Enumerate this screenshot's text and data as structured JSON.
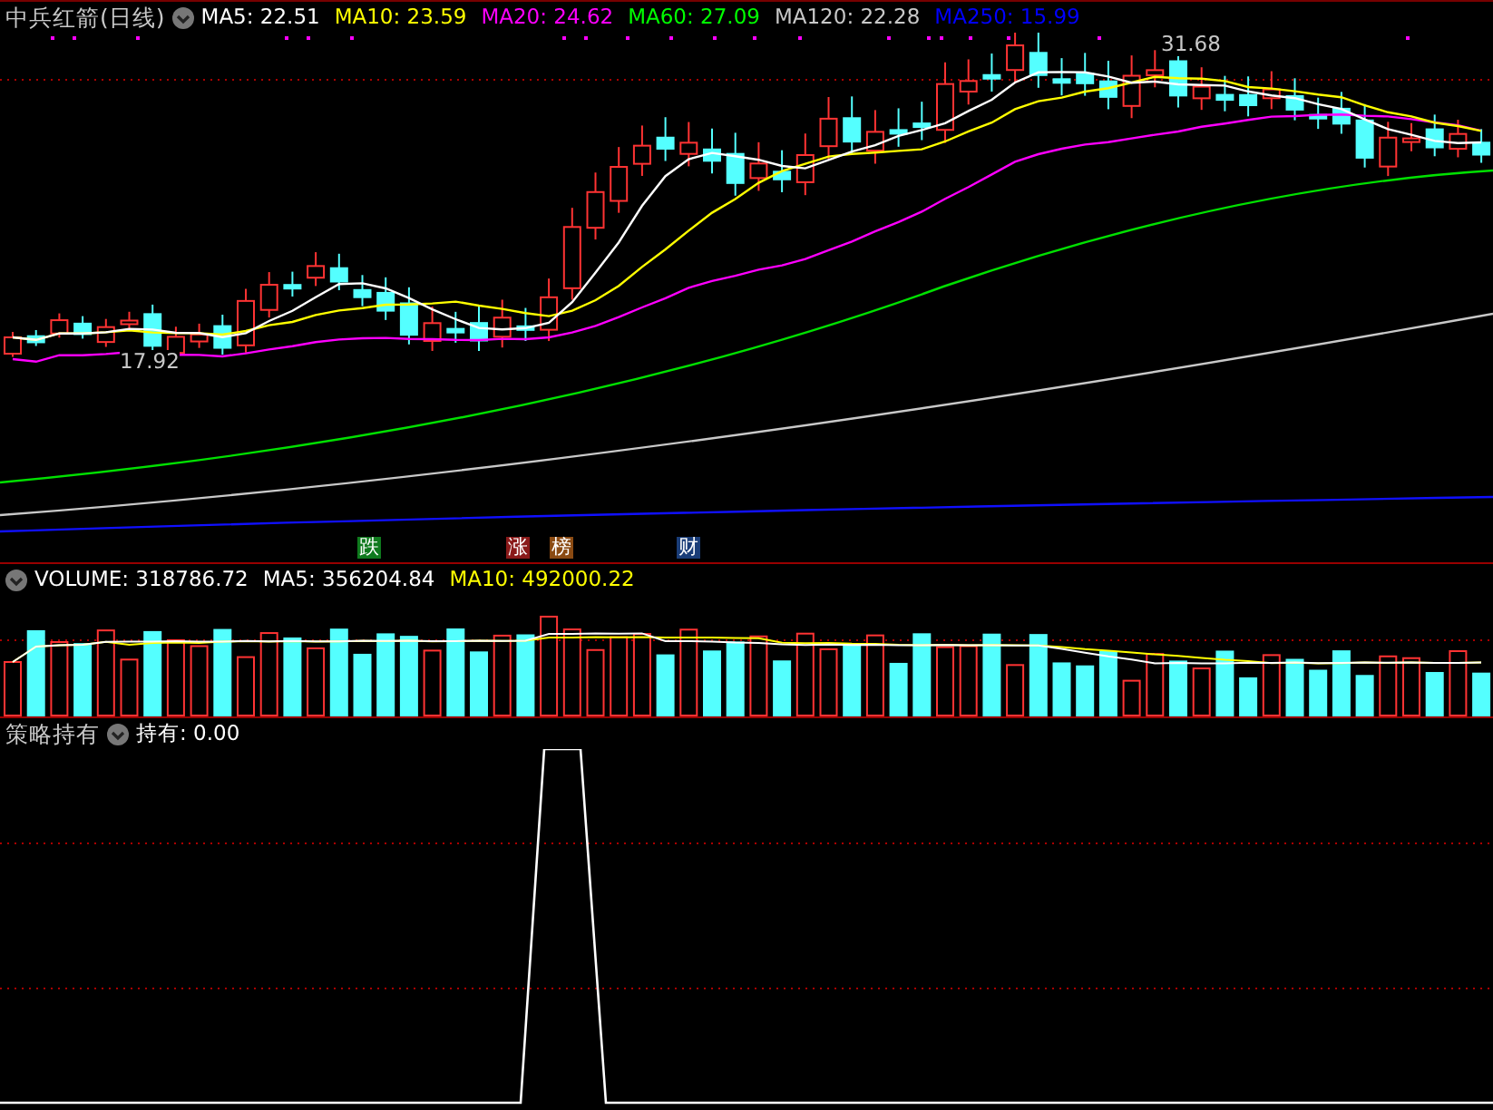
{
  "title": "中兵红箭(日线)",
  "price_indicators": [
    {
      "label": "MA5: 22.51",
      "color": "#ffffff"
    },
    {
      "label": "MA10: 23.59",
      "color": "#ffff00"
    },
    {
      "label": "MA20: 24.62",
      "color": "#ff00ff"
    },
    {
      "label": "MA60: 27.09",
      "color": "#00ff00"
    },
    {
      "label": "MA120: 22.28",
      "color": "#c8c8c8"
    },
    {
      "label": "MA250: 15.99",
      "color": "#0000ff"
    }
  ],
  "price_labels": {
    "high": "31.68",
    "low": "17.92"
  },
  "event_markers": [
    {
      "label": "跌",
      "color": "#0f7a1e"
    },
    {
      "label": "涨",
      "color": "#8a1a1a"
    },
    {
      "label": "榜",
      "color": "#8a4a12"
    },
    {
      "label": "财",
      "color": "#1a3d78"
    }
  ],
  "volume_panel": {
    "indicators": [
      {
        "label": "VOLUME: 318786.72",
        "color": "#ffffff"
      },
      {
        "label": "MA5: 356204.84",
        "color": "#ffffff"
      },
      {
        "label": "MA10: 492000.22",
        "color": "#ffff00"
      }
    ]
  },
  "strategy_panel": {
    "title": "策略持有",
    "indicators": [
      {
        "label": "持有: 0.00",
        "color": "#ffffff"
      }
    ]
  }
}
